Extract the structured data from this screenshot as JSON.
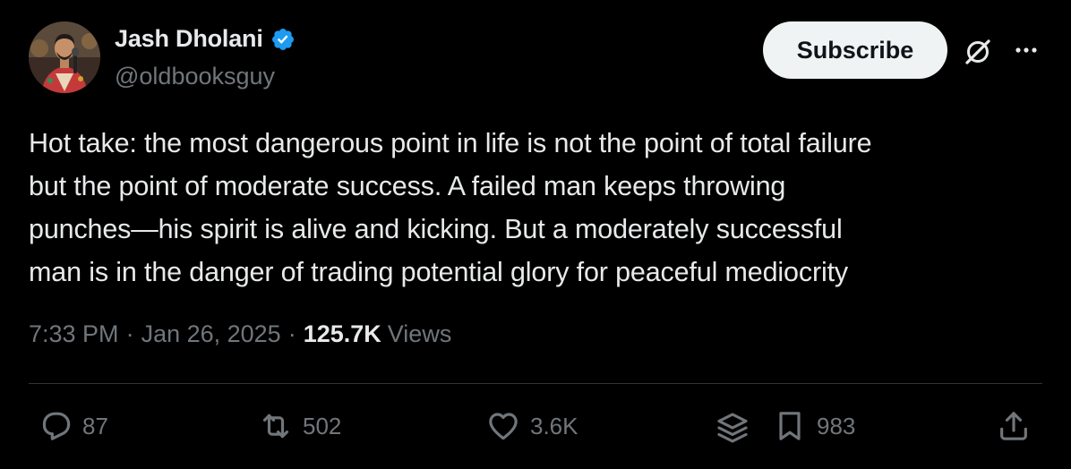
{
  "author": {
    "display_name": "Jash Dholani",
    "handle": "@oldbooksguy",
    "verified": true,
    "verified_color": "#1d9bf0"
  },
  "header": {
    "subscribe_label": "Subscribe",
    "icons": [
      "grok-icon",
      "more-icon"
    ]
  },
  "tweet": {
    "text": "Hot take: the most dangerous point in life is not the point of total failure\nbut the point of moderate success. A failed man keeps throwing\npunches—his spirit is alive and kicking. But a moderately successful\nman is in the danger of trading potential glory for peaceful mediocrity"
  },
  "meta": {
    "time": "7:33 PM",
    "separator": "·",
    "date": "Jan 26, 2025",
    "views_count": "125.7K",
    "views_label": "Views"
  },
  "actions": {
    "replies": "87",
    "reposts": "502",
    "likes": "3.6K",
    "bookmarks": "983",
    "icons": [
      "reply-icon",
      "repost-icon",
      "like-icon",
      "layers-icon",
      "bookmark-icon",
      "share-icon"
    ]
  },
  "colors": {
    "background": "#000000",
    "text": "#e7e9ea",
    "secondary": "#71767b",
    "divider": "#2f3336",
    "button_bg": "#eff3f4"
  }
}
